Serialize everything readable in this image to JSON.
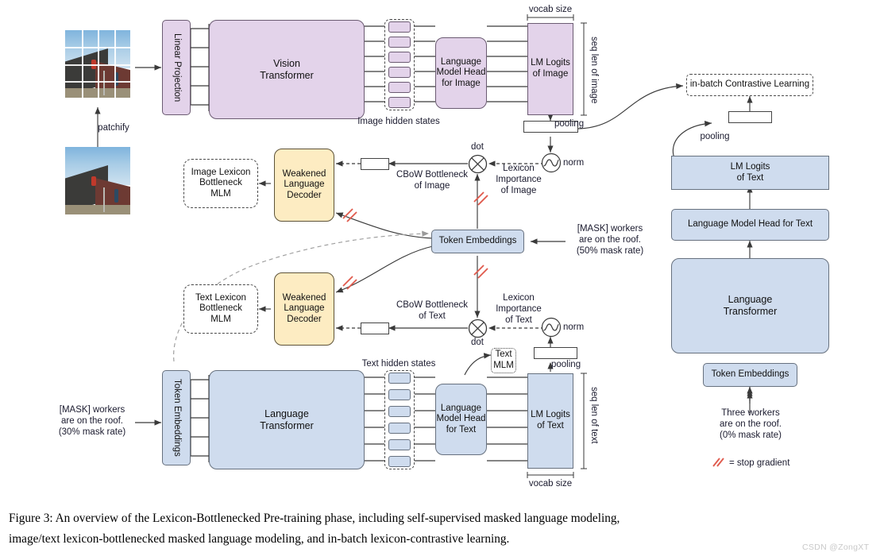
{
  "figure": {
    "caption_line1": "Figure 3: An overview of the Lexicon-Bottlenecked Pre-training phase, including self-supervised masked language modeling,",
    "caption_line2": "image/text lexicon-bottlenecked masked language modeling, and in-batch lexicon-contrastive learning.",
    "watermark": "CSDN @ZongXT"
  },
  "image_branch": {
    "patchify_label": "patchify",
    "linear_projection": "Linear Projection",
    "vision_transformer": "Vision\nTransformer",
    "image_hidden_states": "Image hidden states",
    "lm_head_image": "Language\nModel Head\nfor Image",
    "lm_logits_image": "LM Logits\nof Image",
    "vocab_size": "vocab size",
    "seq_len_image": "seq len of image",
    "pooling": "pooling",
    "norm": "norm",
    "lexicon_importance_image": "Lexicon\nImportance\nof Image",
    "dot": "dot",
    "cbow_bottleneck_image": "CBoW Bottleneck\nof Image",
    "weakened_language_decoder": "Weakened\nLanguage\nDecoder",
    "image_lexicon_bottleneck_mlm": "Image Lexicon\nBottleneck\nMLM"
  },
  "center": {
    "token_embeddings": "Token Embeddings",
    "mask_input_50": "[MASK] workers\nare on the roof.\n(50% mask rate)"
  },
  "text_branch": {
    "text_lexicon_bottleneck_mlm": "Text Lexicon\nBottleneck\nMLM",
    "weakened_language_decoder": "Weakened\nLanguage\nDecoder",
    "cbow_bottleneck_text": "CBoW Bottleneck\nof Text",
    "dot": "dot",
    "lexicon_importance_text": "Lexicon\nImportance\nof Text",
    "norm": "norm",
    "pooling": "pooling",
    "text_mlm": "Text\nMLM",
    "mask_input_30": "[MASK] workers\nare on the roof.\n(30% mask rate)",
    "token_embeddings": "Token Embeddings",
    "language_transformer": "Language\nTransformer",
    "text_hidden_states": "Text hidden states",
    "lm_head_text": "Language\nModel Head\nfor Text",
    "lm_logits_text": "LM Logits\nof Text",
    "seq_len_text": "seq len of text",
    "vocab_size": "vocab size"
  },
  "right_branch": {
    "in_batch_contrastive_learning": "in-batch Contrastive Learning",
    "pooling": "pooling",
    "lm_logits_text": "LM Logits\nof Text",
    "lm_head_text": "Language\nModel Head for Text",
    "language_transformer": "Language\nTransformer",
    "token_embeddings": "Token Embeddings",
    "clean_input": "Three workers\nare on the roof.\n(0% mask rate)",
    "legend_stop_gradient": "= stop gradient"
  },
  "colors": {
    "image_fill": "#e3d3ea",
    "text_fill": "#cfdcee",
    "decoder_fill": "#fdecc2",
    "stop_gradient": "#e05b4e",
    "stroke": "#444444"
  }
}
